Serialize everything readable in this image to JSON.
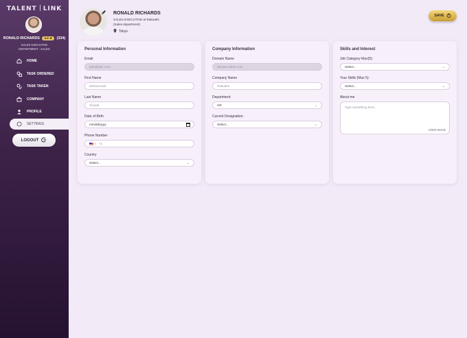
{
  "app": {
    "logo_left": "TALENT",
    "logo_right": "LINK"
  },
  "sidebar": {
    "user_name": "RONALD RICHARDS",
    "rating": "4.4 ★",
    "reviews": "(334)",
    "role_line1": "SALES EXECUTIVE",
    "role_line2": "DEPARTMENT : SALES",
    "items": [
      {
        "label": "HOME",
        "icon": "home-icon"
      },
      {
        "label": "TASK ORDERED",
        "icon": "task-ordered-icon"
      },
      {
        "label": "TASK TAKEN",
        "icon": "task-taken-icon"
      },
      {
        "label": "COMPANY",
        "icon": "company-icon"
      },
      {
        "label": "PROFILE",
        "icon": "profile-icon"
      },
      {
        "label": "SETTINGS",
        "icon": "settings-icon"
      }
    ],
    "logout_label": "LOGOUT"
  },
  "header": {
    "name": "RONALD RICHARDS",
    "role": "SALES EXECUTIVE at Rakuahs",
    "department": "(Sales department)",
    "location": "Tokyo",
    "save_label": "SAVE"
  },
  "personal": {
    "title": "Personal Information",
    "email_label": "Email",
    "email_value": "john@abc.com",
    "first_name_label": "First Name",
    "first_name_value": "Muhammad",
    "last_name_label": "Last Name",
    "last_name_value": "Shoaib",
    "dob_label": "Date of Birth",
    "dob_placeholder": "mm/dd/yyyy",
    "phone_label": "Phone Number",
    "phone_value": "+1",
    "country_label": "Country",
    "country_value": "Select..."
  },
  "company": {
    "title": "Company Information",
    "domain_label": "Domain Name",
    "domain_value": "domain.talent.com",
    "company_label": "Company Name",
    "company_value": "Rakuahs",
    "department_label": "Department:",
    "department_value": "HR",
    "designation_label": "Current Designation:",
    "designation_value": "Select..."
  },
  "skills": {
    "title": "Skills and Interest",
    "job_cat_label": "Job Category Max(5):",
    "job_cat_value": "Select...",
    "skills_label": "Your Skills (Max 5):",
    "skills_value": "Select...",
    "about_label": "About me",
    "about_placeholder": "Type something here...",
    "word_count": "0/200 Words"
  },
  "colors": {
    "accent_gold": "#e2c063",
    "sidebar_dark": "#3c2247",
    "background": "#f3eaf7"
  }
}
